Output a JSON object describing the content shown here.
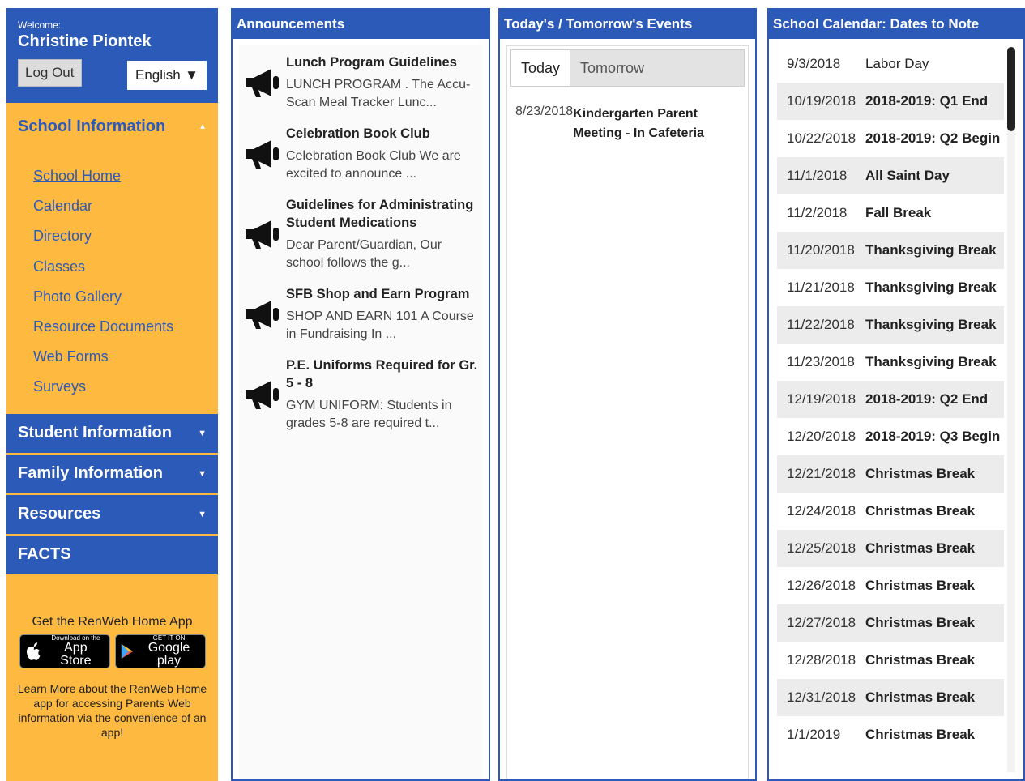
{
  "user": {
    "welcome_label": "Welcome:",
    "name": "Christine Piontek",
    "logout_label": "Log Out",
    "language": "English"
  },
  "sidebar": {
    "school_info": {
      "title": "School Information",
      "items": [
        "School Home",
        "Calendar",
        "Directory",
        "Classes",
        "Photo Gallery",
        "Resource Documents",
        "Web Forms",
        "Surveys"
      ]
    },
    "sections": [
      "Student Information",
      "Family Information",
      "Resources",
      "FACTS"
    ],
    "app_promo": {
      "title": "Get the RenWeb Home App",
      "appstore_small": "Download on the",
      "appstore_large": "App Store",
      "googleplay_small": "GET IT ON",
      "googleplay_large": "Google play",
      "learn_more_link": "Learn More",
      "learn_more_text": "about the RenWeb Home app for accessing Parents Web information via the convenience of an app!"
    }
  },
  "announcements": {
    "title": "Announcements",
    "items": [
      {
        "title": "Lunch Program Guidelines",
        "text": "LUNCH PROGRAM . The Accu-Scan Meal Tracker Lunc..."
      },
      {
        "title": "Celebration Book Club",
        "text": "Celebration Book Club We are excited to announce ..."
      },
      {
        "title": "Guidelines for Administrating Student Medications",
        "text": "Dear Parent/Guardian, Our school follows the g..."
      },
      {
        "title": "SFB Shop and Earn Program",
        "text": "SHOP AND EARN 101 A Course in Fundraising In ..."
      },
      {
        "title": "P.E. Uniforms Required for Gr. 5 - 8",
        "text": "GYM UNIFORM: Students in grades 5-8 are required t..."
      }
    ]
  },
  "events": {
    "title": "Today's / Tomorrow's Events",
    "tabs": [
      "Today",
      "Tomorrow"
    ],
    "items": [
      {
        "date": "8/23/2018",
        "title": "Kindergarten Parent Meeting - In Cafeteria"
      }
    ]
  },
  "calendar": {
    "title": "School Calendar: Dates to Note",
    "items": [
      {
        "date": "9/3/2018",
        "event": "Labor Day"
      },
      {
        "date": "10/19/2018",
        "event": "2018-2019: Q1 End"
      },
      {
        "date": "10/22/2018",
        "event": "2018-2019: Q2 Begin"
      },
      {
        "date": "11/1/2018",
        "event": "All Saint Day"
      },
      {
        "date": "11/2/2018",
        "event": "Fall Break"
      },
      {
        "date": "11/20/2018",
        "event": "Thanksgiving Break"
      },
      {
        "date": "11/21/2018",
        "event": "Thanksgiving Break"
      },
      {
        "date": "11/22/2018",
        "event": "Thanksgiving Break"
      },
      {
        "date": "11/23/2018",
        "event": "Thanksgiving Break"
      },
      {
        "date": "12/19/2018",
        "event": "2018-2019: Q2 End"
      },
      {
        "date": "12/20/2018",
        "event": "2018-2019: Q3 Begin"
      },
      {
        "date": "12/21/2018",
        "event": "Christmas Break"
      },
      {
        "date": "12/24/2018",
        "event": "Christmas Break"
      },
      {
        "date": "12/25/2018",
        "event": "Christmas Break"
      },
      {
        "date": "12/26/2018",
        "event": "Christmas Break"
      },
      {
        "date": "12/27/2018",
        "event": "Christmas Break"
      },
      {
        "date": "12/28/2018",
        "event": "Christmas Break"
      },
      {
        "date": "12/31/2018",
        "event": "Christmas Break"
      },
      {
        "date": "1/1/2019",
        "event": "Christmas Break"
      }
    ]
  },
  "colors": {
    "primary_blue": "#2c5ab8",
    "sidebar_gold": "#fdb940"
  }
}
